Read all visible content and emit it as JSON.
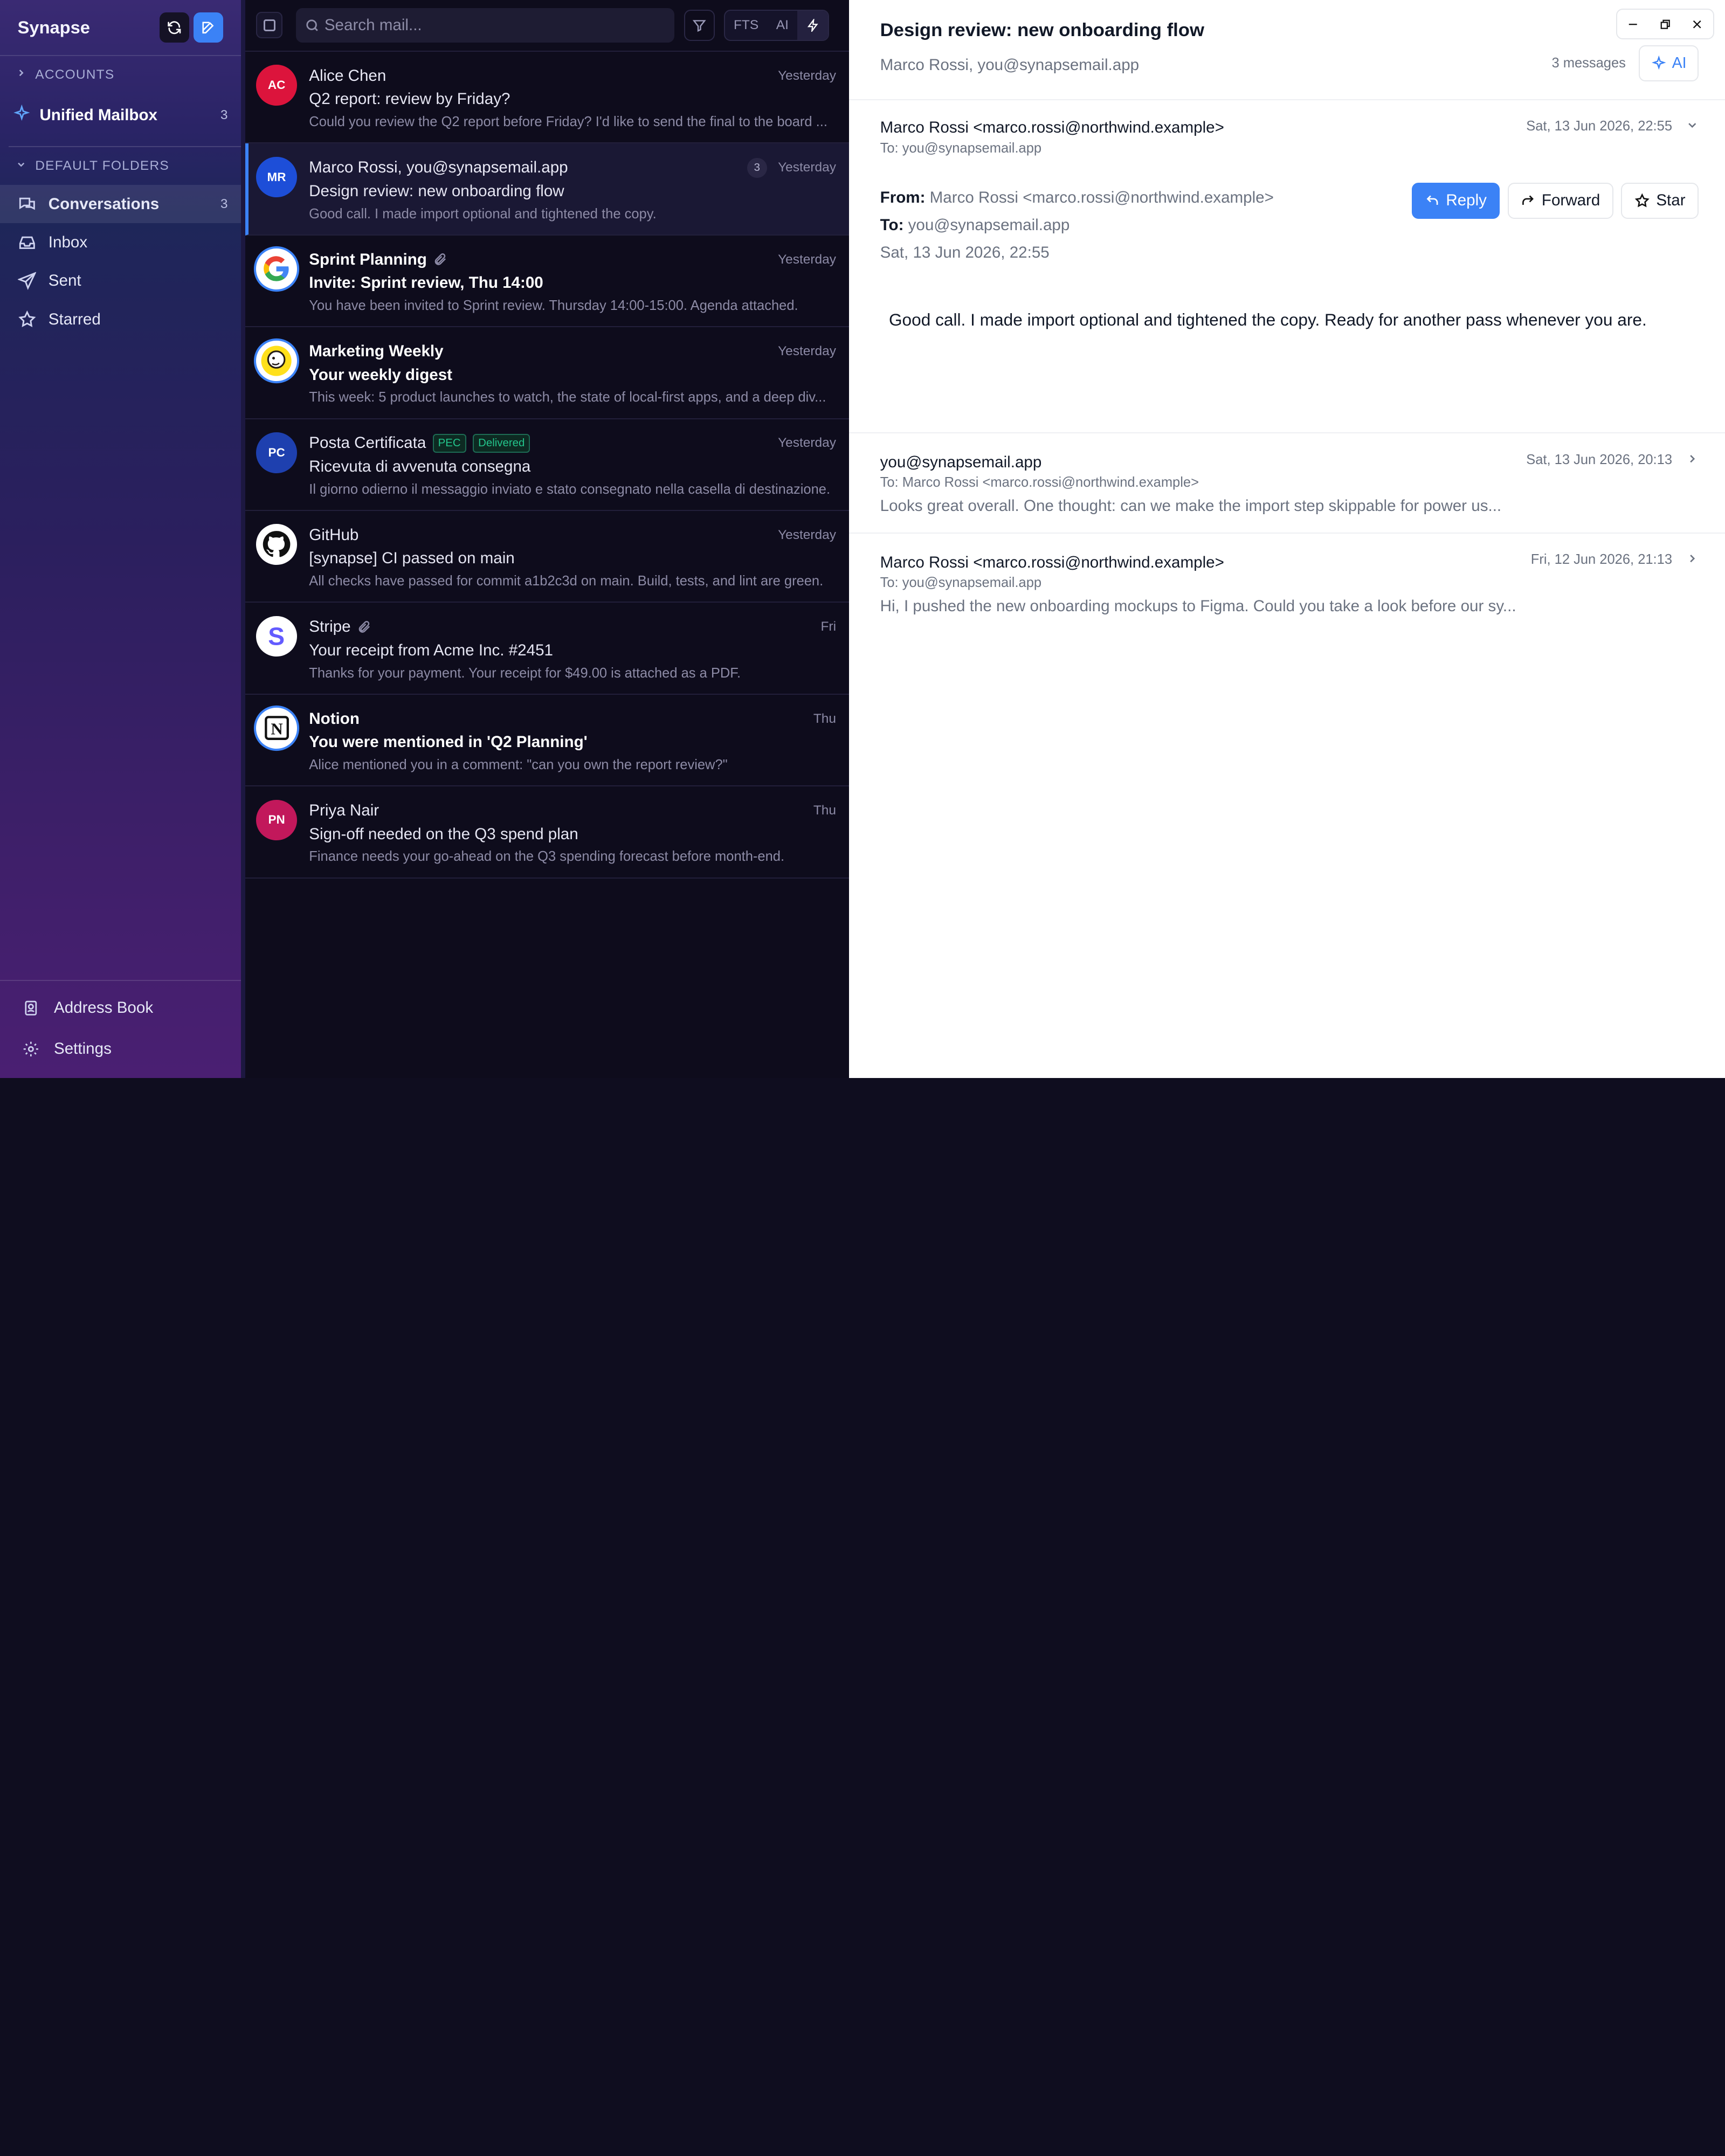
{
  "app": {
    "title": "Synapse"
  },
  "sidebar": {
    "accounts_label": "ACCOUNTS",
    "unified": {
      "label": "Unified Mailbox",
      "count": "3"
    },
    "folders_label": "DEFAULT FOLDERS",
    "folders": [
      {
        "label": "Conversations",
        "count": "3",
        "icon": "conversations-icon"
      },
      {
        "label": "Inbox",
        "count": "",
        "icon": "inbox-icon"
      },
      {
        "label": "Sent",
        "count": "",
        "icon": "send-icon"
      },
      {
        "label": "Starred",
        "count": "",
        "icon": "star-icon"
      }
    ],
    "footer": [
      {
        "label": "Address Book",
        "icon": "address-book-icon"
      },
      {
        "label": "Settings",
        "icon": "gear-icon"
      }
    ]
  },
  "list": {
    "search_placeholder": "Search mail...",
    "modes": [
      "FTS",
      "AI"
    ],
    "rows": [
      {
        "avatar": "AC",
        "avatar_color": "#dc143c",
        "sender": "Alice Chen",
        "time": "Yesterday",
        "subject": "Q2 report: review by Friday?",
        "preview": "Could you review the Q2 report before Friday? I'd like to send the final to the board ..."
      },
      {
        "avatar": "MR",
        "avatar_color": "#1d4ed8",
        "sender": "Marco Rossi, you@synapsemail.app",
        "count": "3",
        "time": "Yesterday",
        "subject": "Design review: new onboarding flow",
        "preview": "Good call. I made import optional and tightened the copy."
      },
      {
        "avatar": "G",
        "sender": "Sprint Planning",
        "time": "Yesterday",
        "subject": "Invite: Sprint review, Thu 14:00",
        "preview": "You have been invited to Sprint review. Thursday 14:00-15:00. Agenda attached."
      },
      {
        "avatar": "",
        "sender": "Marketing Weekly",
        "time": "Yesterday",
        "subject": "Your weekly digest",
        "preview": "This week: 5 product launches to watch, the state of local-first apps, and a deep div..."
      },
      {
        "avatar": "PC",
        "avatar_color": "#1e40af",
        "sender": "Posta Certificata",
        "tag1": "PEC",
        "tag2": "Delivered",
        "time": "Yesterday",
        "subject": "Ricevuta di avvenuta consegna",
        "preview": "Il giorno odierno il messaggio inviato e stato consegnato nella casella di destinazione."
      },
      {
        "avatar": "",
        "sender": "GitHub",
        "time": "Yesterday",
        "subject": "[synapse] CI passed on main",
        "preview": "All checks have passed for commit a1b2c3d on main. Build, tests, and lint are green."
      },
      {
        "avatar": "S",
        "sender": "Stripe",
        "time": "Fri",
        "subject": "Your receipt from Acme Inc. #2451",
        "preview": "Thanks for your payment. Your receipt for $49.00 is attached as a PDF."
      },
      {
        "avatar": "N",
        "sender": "Notion",
        "time": "Thu",
        "subject": "You were mentioned in 'Q2 Planning'",
        "preview": "Alice mentioned you in a comment: \"can you own the report review?\""
      },
      {
        "avatar": "PN",
        "avatar_color": "#c2185b",
        "sender": "Priya Nair",
        "time": "Thu",
        "subject": "Sign-off needed on the Q3 spend plan",
        "preview": "Finance needs your go-ahead on the Q3 spending forecast before month-end."
      }
    ]
  },
  "pane": {
    "title": "Design review: new onboarding flow",
    "participants": "Marco Rossi, you@synapsemail.app",
    "message_count": "3 messages",
    "ai_label": "AI",
    "open_message": {
      "from": "Marco Rossi <marco.rossi@northwind.example>",
      "to": "To: you@synapsemail.app",
      "date": "Sat, 13 Jun 2026, 22:55",
      "from_label": "From:",
      "from_value": "Marco Rossi <marco.rossi@northwind.example>",
      "to_label": "To:",
      "to_value": "you@synapsemail.app",
      "date_line": "Sat, 13 Jun 2026, 22:55",
      "body": "Good call. I made import optional and tightened the copy. Ready for another pass whenever you are.",
      "reply": "Reply",
      "forward": "Forward",
      "star": "Star"
    },
    "collapsed": [
      {
        "from": "you@synapsemail.app",
        "to": "To: Marco Rossi <marco.rossi@northwind.example>",
        "date": "Sat, 13 Jun 2026, 20:13",
        "preview": "Looks great overall. One thought: can we make the import step skippable for power us..."
      },
      {
        "from": "Marco Rossi <marco.rossi@northwind.example>",
        "to": "To: you@synapsemail.app",
        "date": "Fri, 12 Jun 2026, 21:13",
        "preview": "Hi, I pushed the new onboarding mockups to Figma. Could you take a look before our sy..."
      }
    ]
  }
}
